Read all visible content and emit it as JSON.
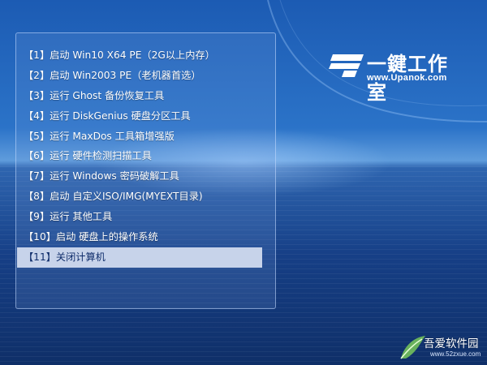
{
  "menu": {
    "items": [
      {
        "label": "【1】启动 Win10 X64 PE（2G以上内存）"
      },
      {
        "label": "【2】启动 Win2003 PE（老机器首选）"
      },
      {
        "label": "【3】运行 Ghost 备份恢复工具"
      },
      {
        "label": "【4】运行 DiskGenius 硬盘分区工具"
      },
      {
        "label": "【5】运行 MaxDos 工具箱增强版"
      },
      {
        "label": "【6】运行 硬件检测扫描工具"
      },
      {
        "label": "【7】运行 Windows 密码破解工具"
      },
      {
        "label": "【8】启动 自定义ISO/IMG(MYEXT目录)"
      },
      {
        "label": "【9】运行 其他工具"
      },
      {
        "label": "【10】启动 硬盘上的操作系统"
      },
      {
        "label": "【11】关闭计算机"
      }
    ],
    "selected_index": 10
  },
  "brand": {
    "name": "一鍵工作室",
    "url": "www.Upanok.com"
  },
  "watermark": {
    "name": "吾爱软件园",
    "url": "www.52zxue.com"
  },
  "colors": {
    "selection_bg": "#c7d3ea",
    "selection_text": "#0f2d6b",
    "menu_text": "#ffffff"
  }
}
